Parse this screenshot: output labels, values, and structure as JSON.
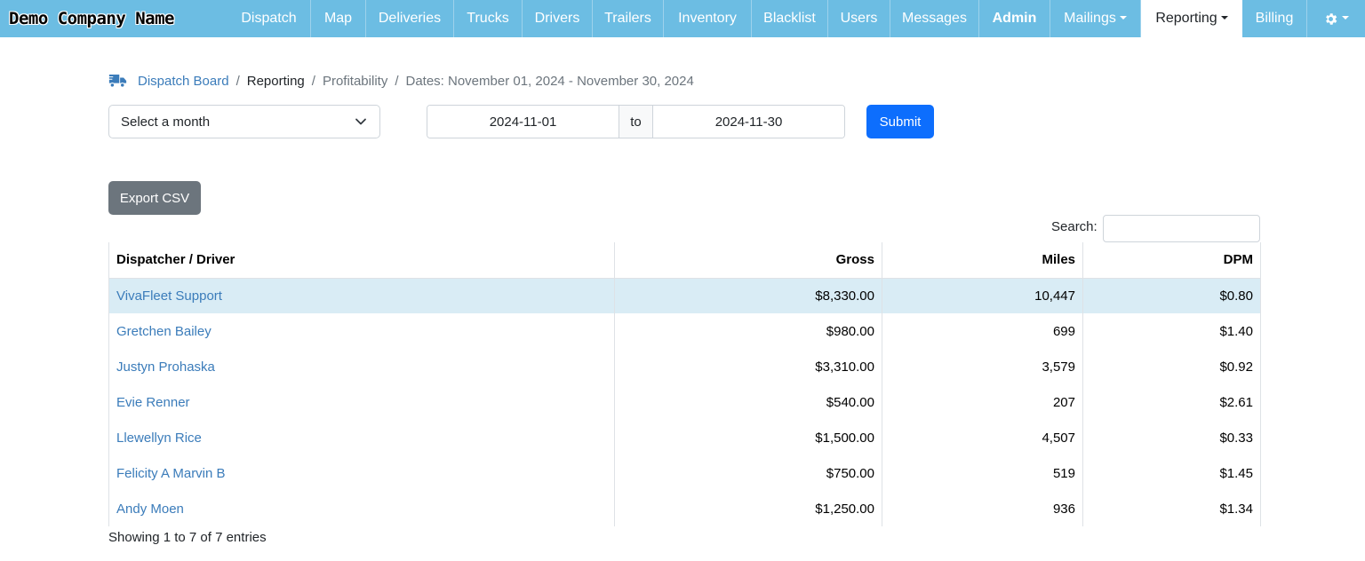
{
  "nav": {
    "brand": "Demo Company Name",
    "items": [
      {
        "label": "Dispatch",
        "width": 94
      },
      {
        "label": "Map",
        "width": 62
      },
      {
        "label": "Deliveries",
        "width": 99
      },
      {
        "label": "Trucks",
        "width": 77
      },
      {
        "label": "Drivers",
        "width": 79
      },
      {
        "label": "Trailers",
        "width": 80
      },
      {
        "label": "Inventory",
        "width": 99
      },
      {
        "label": "Blacklist",
        "width": 86
      },
      {
        "label": "Users",
        "width": 70
      },
      {
        "label": "Messages",
        "width": 100
      },
      {
        "label": "Admin",
        "width": 80
      },
      {
        "label": "Mailings",
        "width": 102
      },
      {
        "label": "Reporting",
        "width": 114
      },
      {
        "label": "Billing",
        "width": 73
      }
    ],
    "settings_icon": "gear-icon"
  },
  "breadcrumb": {
    "icon": "truck-icon",
    "home": "Dispatch Board",
    "reporting": "Reporting",
    "profitability": "Profitability",
    "dates": "Dates: November 01, 2024 - November 30, 2024"
  },
  "filters": {
    "month_placeholder": "Select a month",
    "start_date": "2024-11-01",
    "to_label": "to",
    "end_date": "2024-11-30",
    "submit_label": "Submit",
    "export_label": "Export CSV",
    "search_label": "Search:"
  },
  "table": {
    "headers": [
      "Dispatcher / Driver",
      "Gross",
      "Miles",
      "DPM"
    ],
    "rows": [
      [
        "VivaFleet Support",
        "$8,330.00",
        "10,447",
        "$0.80"
      ],
      [
        "Gretchen Bailey",
        "$980.00",
        "699",
        "$1.40"
      ],
      [
        "Justyn Prohaska",
        "$3,310.00",
        "3,579",
        "$0.92"
      ],
      [
        "Evie Renner",
        "$540.00",
        "207",
        "$2.61"
      ],
      [
        "Llewellyn Rice",
        "$1,500.00",
        "4,507",
        "$0.33"
      ],
      [
        "Felicity A Marvin B",
        "$750.00",
        "519",
        "$1.45"
      ],
      [
        "Andy Moen",
        "$1,250.00",
        "936",
        "$1.34"
      ]
    ],
    "footer": "Showing 1 to 7 of 7 entries"
  },
  "colors": {
    "navbar": "#6cbde3",
    "link": "#3b7cba",
    "primary": "#0d6efd",
    "secondary": "#6c757d",
    "highlight_row": "#d9ecf5"
  }
}
